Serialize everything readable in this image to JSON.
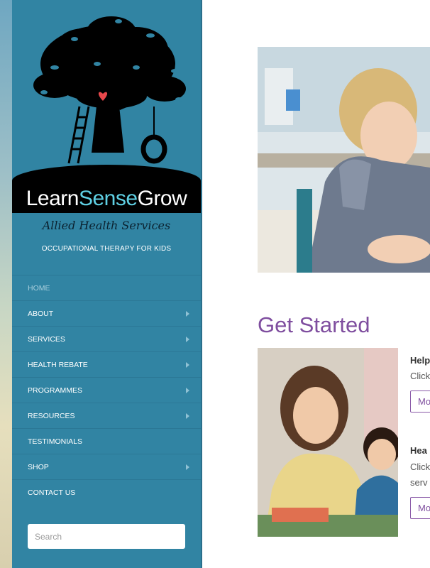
{
  "brand": {
    "name_part1": "Learn",
    "name_part2": "Sense",
    "name_part3": "Grow",
    "tagline": "Allied Health Services",
    "subtitle": "OCCUPATIONAL THERAPY FOR KIDS"
  },
  "nav": {
    "items": [
      {
        "label": "HOME",
        "active": true,
        "has_submenu": false
      },
      {
        "label": "ABOUT",
        "active": false,
        "has_submenu": true
      },
      {
        "label": "SERVICES",
        "active": false,
        "has_submenu": true
      },
      {
        "label": "HEALTH REBATE",
        "active": false,
        "has_submenu": true
      },
      {
        "label": "PROGRAMMES",
        "active": false,
        "has_submenu": true
      },
      {
        "label": "RESOURCES",
        "active": false,
        "has_submenu": true
      },
      {
        "label": "TESTIMONIALS",
        "active": false,
        "has_submenu": false
      },
      {
        "label": "SHOP",
        "active": false,
        "has_submenu": true
      },
      {
        "label": "CONTACT US",
        "active": false,
        "has_submenu": false
      }
    ]
  },
  "search": {
    "placeholder": "Search"
  },
  "main": {
    "heading": "Get Started",
    "items": [
      {
        "title": "Help",
        "text_line1": "Click",
        "text_line2": "",
        "button": "Mo"
      },
      {
        "title": "Hea",
        "text_line1": "Click",
        "text_line2": "serv",
        "button": "Mo"
      }
    ]
  },
  "colors": {
    "sidebar": "#3184a3",
    "accent_purple": "#7f4e9f",
    "brand_sense": "#5fd0e4"
  }
}
